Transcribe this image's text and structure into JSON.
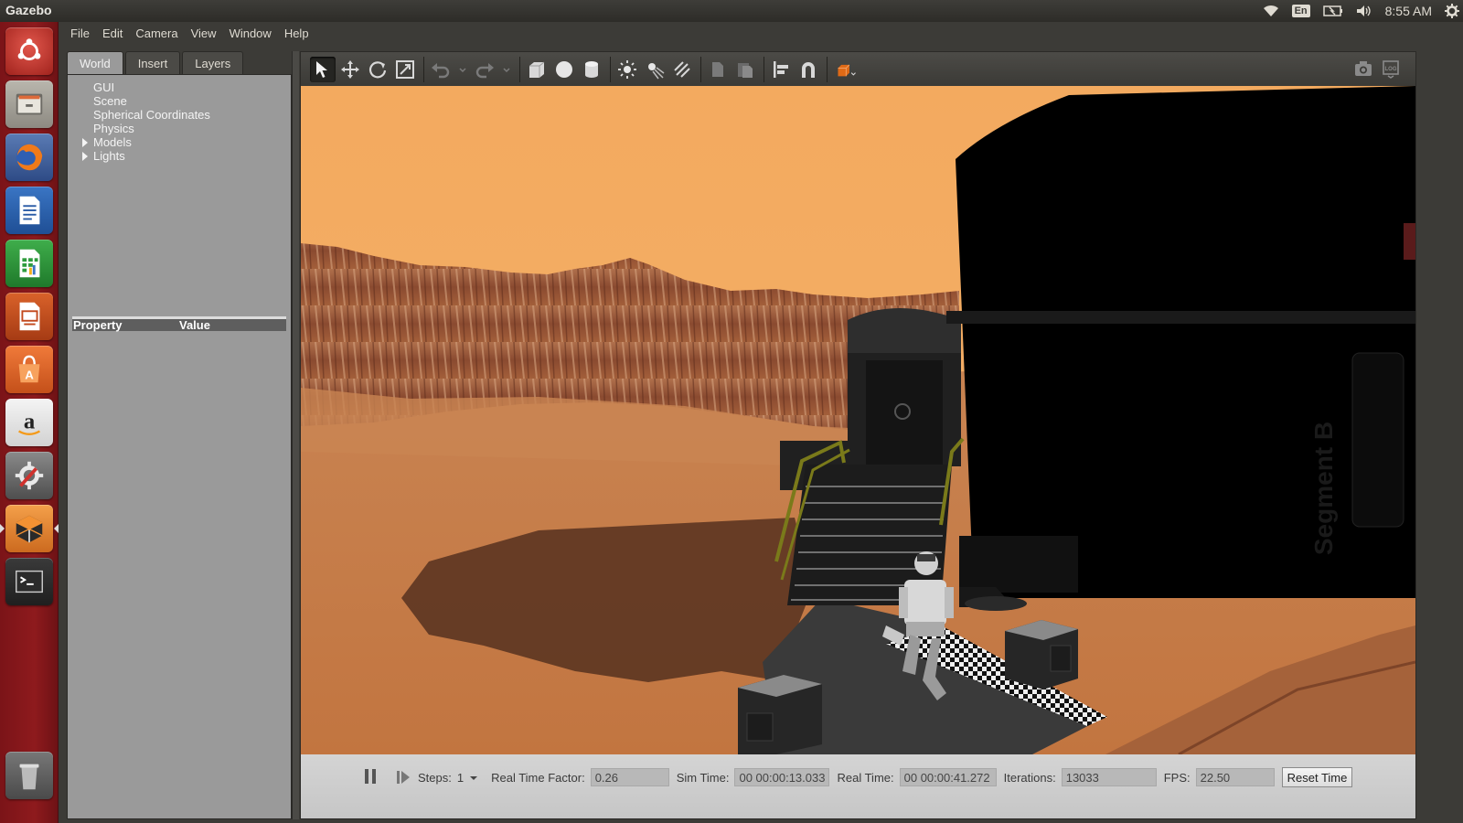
{
  "app_title": "Gazebo",
  "tray": {
    "lang": "En",
    "clock": "8:55 AM"
  },
  "launcher": {
    "items": [
      "ubuntu-dash-icon",
      "files-icon",
      "firefox-icon",
      "writer-icon",
      "calc-icon",
      "impress-icon",
      "software-center-icon",
      "amazon-icon",
      "system-settings-icon",
      "gazebo-icon",
      "terminal-icon",
      "trash-icon"
    ]
  },
  "menu": {
    "file": "File",
    "edit": "Edit",
    "camera": "Camera",
    "view": "View",
    "window": "Window",
    "help": "Help"
  },
  "left_panel": {
    "tabs": [
      "World",
      "Insert",
      "Layers"
    ],
    "tree": [
      "GUI",
      "Scene",
      "Spherical Coordinates",
      "Physics",
      "Models",
      "Lights"
    ],
    "property_header": "Property",
    "value_header": "Value"
  },
  "scene": {
    "building_label": "Segment B"
  },
  "bottom_bar": {
    "steps_label": "Steps:",
    "steps_value": "1",
    "rtf_label": "Real Time Factor:",
    "rtf_value": "0.26",
    "sim_time_label": "Sim Time:",
    "sim_time_value": "00 00:00:13.033",
    "real_time_label": "Real Time:",
    "real_time_value": "00 00:00:41.272",
    "iterations_label": "Iterations:",
    "iterations_value": "13033",
    "fps_label": "FPS:",
    "fps_value": "22.50",
    "reset_time": "Reset Time"
  },
  "colors": {
    "sky": "#f2aa63",
    "ground": "#c97a44",
    "launcher": "#8e1a1d",
    "panel": "#9a9a9a"
  }
}
